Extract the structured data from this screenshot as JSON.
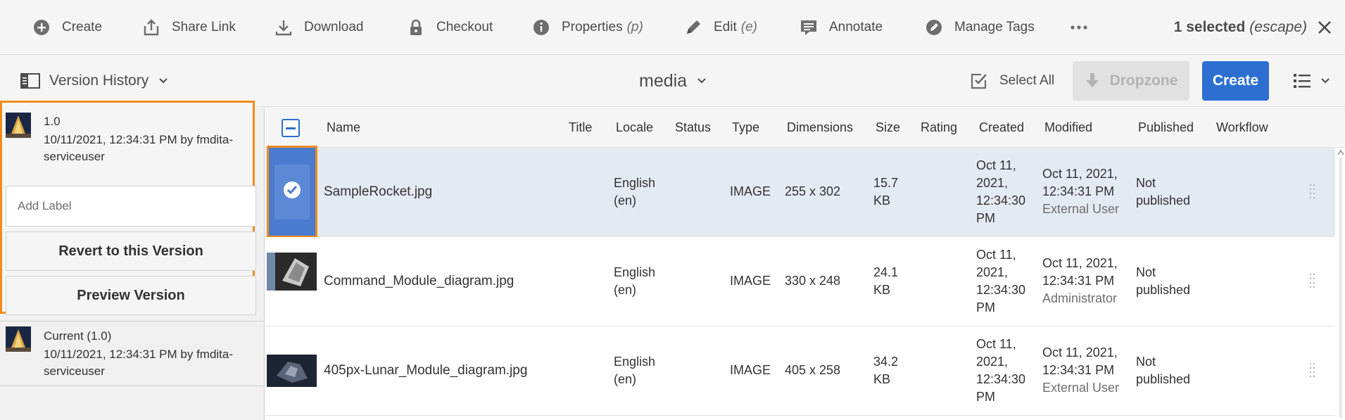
{
  "actions": {
    "create": "Create",
    "share_link": "Share Link",
    "download": "Download",
    "checkout": "Checkout",
    "properties": "Properties",
    "properties_key": "(p)",
    "edit": "Edit",
    "edit_key": "(e)",
    "annotate": "Annotate",
    "manage_tags": "Manage Tags",
    "selected": "1 selected",
    "escape": "(escape)"
  },
  "subbar": {
    "rail_label": "Version History",
    "crumb": "media",
    "select_all": "Select All",
    "dropzone": "Dropzone",
    "create": "Create"
  },
  "rail": {
    "version": {
      "number": "1.0",
      "meta": "10/11/2021, 12:34:31 PM by fmdita-serviceuser",
      "label_placeholder": "Add Label",
      "revert": "Revert to this Version",
      "preview": "Preview Version"
    },
    "current": {
      "number": "Current  (1.0)",
      "meta": "10/11/2021, 12:34:31 PM by fmdita-serviceuser"
    }
  },
  "table": {
    "headers": {
      "name": "Name",
      "title": "Title",
      "locale": "Locale",
      "status": "Status",
      "type": "Type",
      "dimensions": "Dimensions",
      "size": "Size",
      "rating": "Rating",
      "created": "Created",
      "modified": "Modified",
      "published": "Published",
      "workflow": "Workflow"
    },
    "rows": [
      {
        "name": "SampleRocket.jpg",
        "locale": "English (en)",
        "type": "IMAGE",
        "dimensions": "255 x 302",
        "size": "15.7 KB",
        "created": "Oct 11, 2021, 12:34:30 PM",
        "modified": "Oct 11, 2021, 12:34:31 PM",
        "modified_by": "External User",
        "published": "Not published"
      },
      {
        "name": "Command_Module_diagram.jpg",
        "locale": "English (en)",
        "type": "IMAGE",
        "dimensions": "330 x 248",
        "size": "24.1 KB",
        "created": "Oct 11, 2021, 12:34:30 PM",
        "modified": "Oct 11, 2021, 12:34:31 PM",
        "modified_by": "Administrator",
        "published": "Not published"
      },
      {
        "name": "405px-Lunar_Module_diagram.jpg",
        "locale": "English (en)",
        "type": "IMAGE",
        "dimensions": "405 x 258",
        "size": "34.2 KB",
        "created": "Oct 11, 2021, 12:34:30 PM",
        "modified": "Oct 11, 2021, 12:34:31 PM",
        "modified_by": "External User",
        "published": "Not published"
      }
    ]
  },
  "colors": {
    "accent": "#2c6fd1",
    "selection_outline": "#f08c1a",
    "selected_row": "#e4eaf2"
  },
  "icons": [
    "plus-circle-icon",
    "share-icon",
    "download-icon",
    "lock-icon",
    "info-icon",
    "pencil-icon",
    "annotate-icon",
    "tag-icon",
    "more-icon",
    "close-icon",
    "rail-icon",
    "chevron-down-icon",
    "select-all-icon",
    "dropzone-icon",
    "list-view-icon",
    "checkmark-icon",
    "drag-handle-icon"
  ]
}
